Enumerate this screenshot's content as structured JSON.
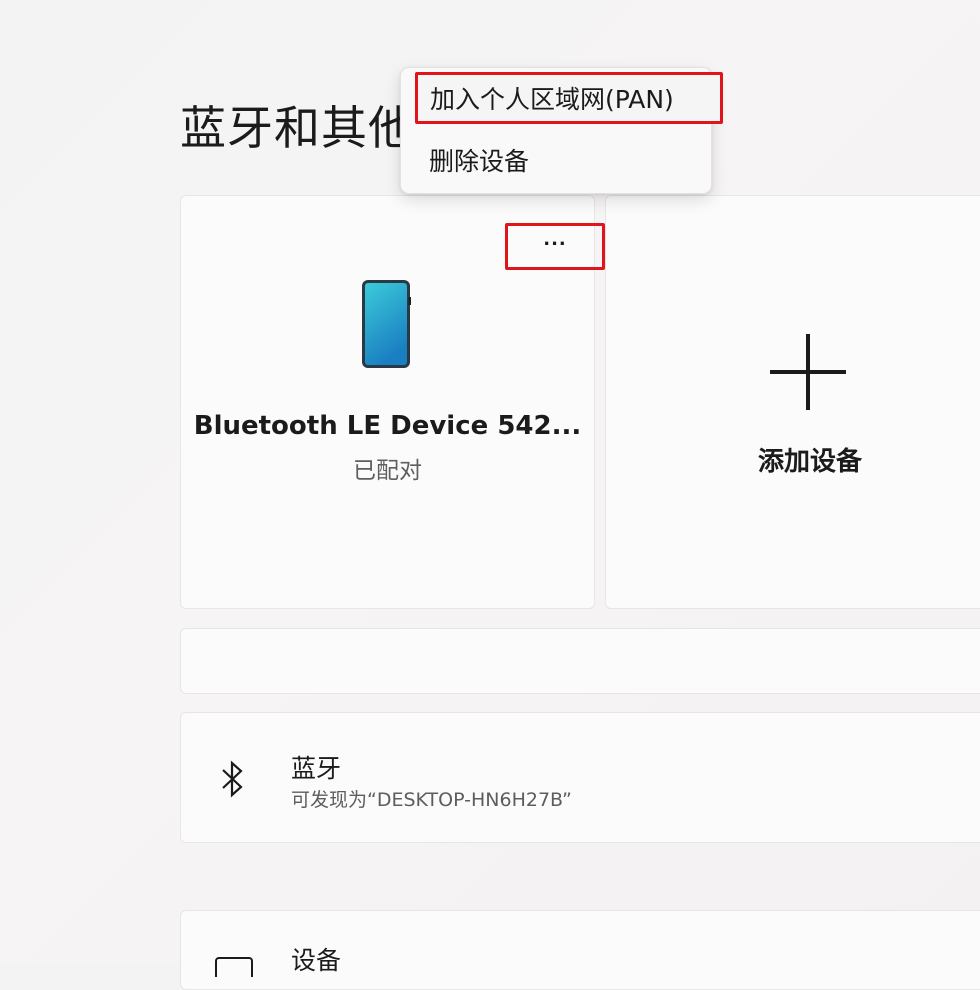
{
  "page": {
    "title": "蓝牙和其他设备"
  },
  "context_menu": {
    "items": [
      {
        "label": "加入个人区域网(PAN)"
      },
      {
        "label": "删除设备"
      }
    ]
  },
  "device_card": {
    "name": "Bluetooth LE Device 542...",
    "status": "已配对",
    "more_label": "...",
    "icon": "phone-icon"
  },
  "add_device": {
    "label": "添加设备",
    "icon": "plus-icon"
  },
  "bluetooth": {
    "title": "蓝牙",
    "subtitle": "可发现为“DESKTOP-HN6H27B”",
    "icon": "bluetooth-icon"
  },
  "devices": {
    "title": "设备",
    "icon": "devices-icon"
  },
  "colors": {
    "highlight_border": "#e0141a",
    "phone_gradient_top": "#35c7d8",
    "phone_gradient_bottom": "#1b84c6"
  }
}
